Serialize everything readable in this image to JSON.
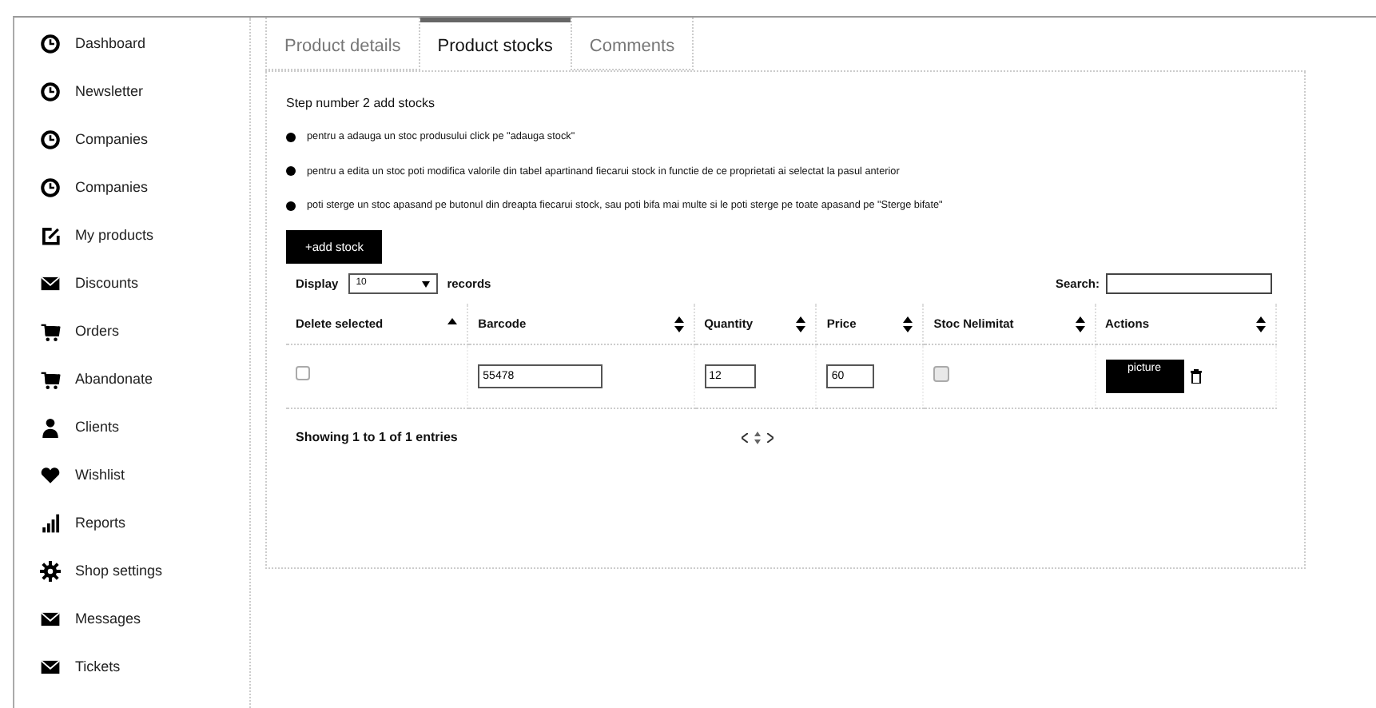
{
  "sidebar": {
    "items": [
      {
        "label": "Dashboard"
      },
      {
        "label": "Newsletter"
      },
      {
        "label": "Companies"
      },
      {
        "label": "Companies"
      },
      {
        "label": "My products"
      },
      {
        "label": "Discounts"
      },
      {
        "label": "Orders"
      },
      {
        "label": "Abandonate"
      },
      {
        "label": "Clients"
      },
      {
        "label": "Wishlist"
      },
      {
        "label": "Reports"
      },
      {
        "label": "Shop settings"
      },
      {
        "label": "Messages"
      },
      {
        "label": "Tickets"
      }
    ]
  },
  "tabs": [
    {
      "label": "Product details",
      "selected": false
    },
    {
      "label": "Product stocks",
      "selected": true
    },
    {
      "label": "Comments",
      "selected": false
    }
  ],
  "step_title": "Step number 2 add stocks",
  "instructions": [
    "pentru a adauga un stoc produsului click pe \"adauga stock\"",
    "pentru a edita un stoc poti modifica valorile din tabel apartinand fiecarui stock in functie de ce proprietati ai selectat la pasul anterior",
    "poti sterge un stoc apasand pe butonul din dreapta fiecarui stock, sau poti bifa mai multe si le poti sterge pe toate apasand pe \"Sterge bifate\""
  ],
  "add_button": "+add stock",
  "length_menu": {
    "prefix": "Display",
    "value": "10",
    "suffix": "records"
  },
  "search": {
    "label": "Search:"
  },
  "table": {
    "columns": [
      {
        "label": "Delete selected",
        "sorted": true
      },
      {
        "label": "Barcode",
        "sorted": false
      },
      {
        "label": "Quantity",
        "sorted": false
      },
      {
        "label": "Price",
        "sorted": false
      },
      {
        "label": "Stoc Nelimitat",
        "sorted": false
      },
      {
        "label": "Actions",
        "sorted": false
      }
    ],
    "rows": [
      {
        "checked": false,
        "barcode": "55478",
        "quantity": "12",
        "price": "60",
        "unlimited": false,
        "action": "picture"
      }
    ]
  },
  "info": "Showing 1 to 1 of 1 entries"
}
